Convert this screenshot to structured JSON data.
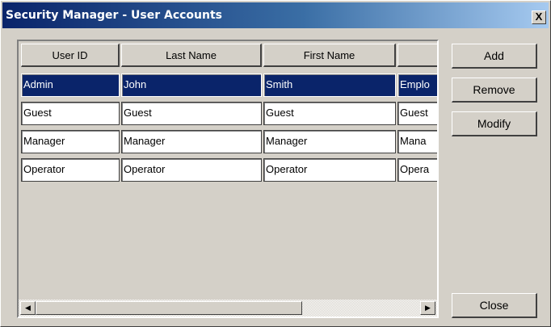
{
  "window": {
    "title": "Security Manager - User Accounts",
    "close_label": "X"
  },
  "grid": {
    "columns": [
      "User ID",
      "Last Name",
      "First Name",
      ""
    ],
    "rows": [
      [
        "Admin",
        "John",
        "Smith",
        "Emplo"
      ],
      [
        "Guest",
        "Guest",
        "Guest",
        "Guest"
      ],
      [
        "Manager",
        "Manager",
        "Manager",
        "Mana"
      ],
      [
        "Operator",
        "Operator",
        "Operator",
        "Opera"
      ]
    ],
    "selected_row": 0
  },
  "scrollbar": {
    "left_arrow": "◀",
    "right_arrow": "▶"
  },
  "buttons": {
    "add": "Add",
    "remove": "Remove",
    "modify": "Modify",
    "close": "Close"
  },
  "colors": {
    "selection": "#0a246a",
    "title_gradient_start": "#0a246a",
    "title_gradient_end": "#a6caf0",
    "face": "#d4d0c8"
  }
}
